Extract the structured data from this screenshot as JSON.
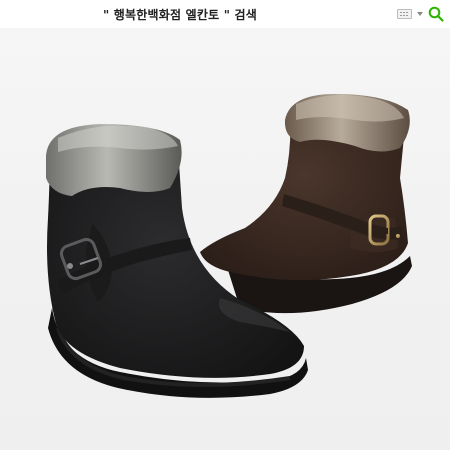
{
  "search": {
    "query_text": "\" 행복한백화점 엘칸토 \" 검색"
  },
  "icons": {
    "keyboard": "keyboard-icon",
    "dropdown": "chevron-down-icon",
    "search": "search-icon"
  },
  "colors": {
    "search_icon": "#2db400",
    "black_boot": "#1d1d1f",
    "brown_boot": "#3a2a22",
    "fur": "#8a8a88"
  }
}
